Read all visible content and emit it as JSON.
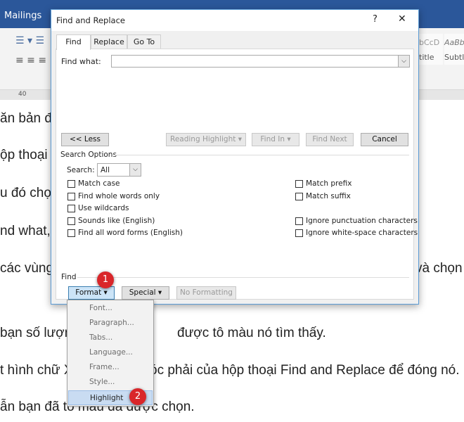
{
  "ribbon": {
    "tab": "Mailings",
    "styles": [
      {
        "preview": "bCcD",
        "name": "title"
      },
      {
        "preview": "AaBb",
        "name": "Subtle"
      }
    ],
    "ruler_mark": "40"
  },
  "document": {
    "lines": [
      "ăn bản đ",
      "ộp thoại",
      "u đó chọ",
      "nd what,",
      " các vùng",
      "và chọn",
      "bạn số lượn",
      "được tô màu nó tìm thấy.",
      "t hình chữ X",
      "óc phải của hộp thoại Find and Replace để đóng nó.",
      "ẫn bạn đã tô màu đã được chọn."
    ]
  },
  "dialog": {
    "title": "Find and Replace",
    "help": "?",
    "close": "✕",
    "tabs": [
      "Find",
      "Replace",
      "Go To"
    ],
    "find_what_label": "Find what:",
    "find_what_value": "",
    "buttons": {
      "less": "<< Less",
      "reading_highlight": "Reading Highlight ▾",
      "find_in": "Find In ▾",
      "find_next": "Find Next",
      "cancel": "Cancel"
    },
    "search_options_label": "Search Options",
    "search_label": "Search:",
    "search_value": "All",
    "options_left": [
      "Match case",
      "Find whole words only",
      "Use wildcards",
      "Sounds like (English)",
      "Find all word forms (English)"
    ],
    "options_right": [
      "Match prefix",
      "Match suffix",
      "Ignore punctuation characters",
      "Ignore white-space characters"
    ],
    "find_section_label": "Find",
    "format": "Format ▾",
    "special": "Special ▾",
    "no_formatting": "No Formatting"
  },
  "format_menu": {
    "items": [
      "Font...",
      "Paragraph...",
      "Tabs...",
      "Language...",
      "Frame...",
      "Style...",
      "Highlight"
    ],
    "highlighted": "Highlight"
  },
  "badges": [
    "1",
    "2"
  ],
  "colors": {
    "ribbon": "#2b579a",
    "badge": "#d9262a",
    "menu_highlight": "#c9dcf2"
  }
}
